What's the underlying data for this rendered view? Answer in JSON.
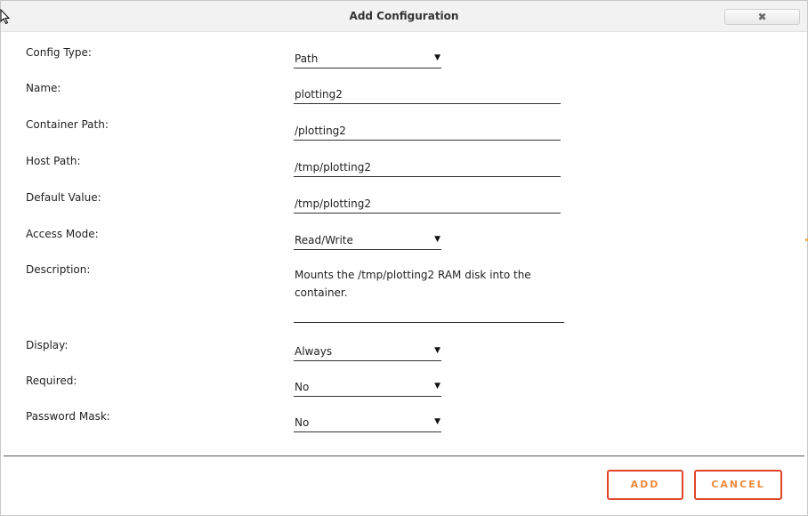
{
  "dialog": {
    "title": "Add Configuration",
    "close_glyph": "✖",
    "close_icon": "close-icon"
  },
  "form": {
    "config_type": {
      "label": "Config Type:",
      "value": "Path"
    },
    "name": {
      "label": "Name:",
      "value": "plotting2"
    },
    "container_path": {
      "label": "Container Path:",
      "value": "/plotting2"
    },
    "host_path": {
      "label": "Host Path:",
      "value": "/tmp/plotting2"
    },
    "default_value": {
      "label": "Default Value:",
      "value": "/tmp/plotting2"
    },
    "access_mode": {
      "label": "Access Mode:",
      "value": "Read/Write"
    },
    "description": {
      "label": "Description:",
      "value": "Mounts the /tmp/plotting2 RAM disk into the container."
    },
    "display": {
      "label": "Display:",
      "value": "Always"
    },
    "required": {
      "label": "Required:",
      "value": "No"
    },
    "password_mask": {
      "label": "Password Mask:",
      "value": "No"
    }
  },
  "dropdown_caret": "▼",
  "buttons": {
    "add": "ADD",
    "cancel": "CANCEL"
  },
  "colors": {
    "button_border": "#e0452b",
    "button_text": "#ef8a3c",
    "titlebar": "#f2f2f2"
  }
}
